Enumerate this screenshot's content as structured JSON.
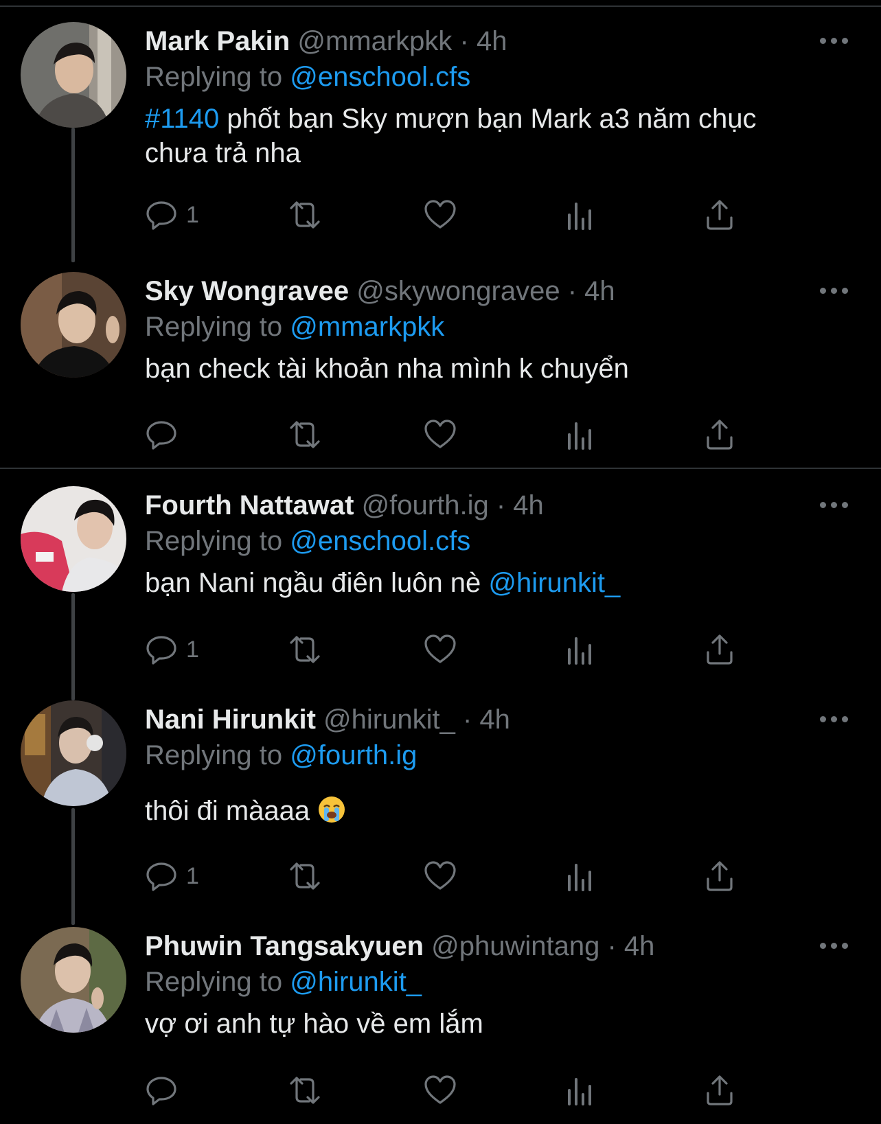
{
  "colors": {
    "background": "#000000",
    "text": "#e7e9ea",
    "muted": "#71767b",
    "link": "#1d9bf0",
    "divider": "#2f3336"
  },
  "tweets": [
    {
      "name": "Mark Pakin",
      "handle": "@mmarkpkk",
      "dot": "·",
      "time": "4h",
      "replying_label": "Replying to",
      "replying_to": "@enschool.cfs",
      "text_link": "#1140",
      "text_main": " phốt bạn Sky mượn bạn Mark a3 năm chục chưa trả nha",
      "text_tail_link": "",
      "reply_count": "1",
      "avatar_icon": "avatar-mark-pakin"
    },
    {
      "name": "Sky Wongravee",
      "handle": "@skywongravee",
      "dot": "·",
      "time": "4h",
      "replying_label": "Replying to",
      "replying_to": "@mmarkpkk",
      "text_link": "",
      "text_main": "bạn check tài khoản nha mình k chuyển",
      "text_tail_link": "",
      "reply_count": "",
      "avatar_icon": "avatar-sky-wongravee"
    },
    {
      "name": "Fourth Nattawat",
      "handle": "@fourth.ig",
      "dot": "·",
      "time": "4h",
      "replying_label": "Replying to",
      "replying_to": "@enschool.cfs",
      "text_link": "",
      "text_main": "bạn Nani ngầu điên luôn nè ",
      "text_tail_link": "@hirunkit_",
      "reply_count": "1",
      "avatar_icon": "avatar-fourth-nattawat"
    },
    {
      "name": "Nani Hirunkit",
      "handle": "@hirunkit_",
      "dot": "·",
      "time": "4h",
      "replying_label": "Replying to",
      "replying_to": "@fourth.ig",
      "text_link": "",
      "text_main": "thôi đi màaaa ",
      "text_tail_link": "",
      "reply_count": "1",
      "avatar_icon": "avatar-nani-hirunkit",
      "emoji_icon": "loudly-crying-face-icon"
    },
    {
      "name": "Phuwin Tangsakyuen",
      "handle": "@phuwintang",
      "dot": "·",
      "time": "4h",
      "replying_label": "Replying to",
      "replying_to": "@hirunkit_",
      "text_link": "",
      "text_main": "vợ ơi anh tự hào về em lắm",
      "text_tail_link": "",
      "reply_count": "",
      "avatar_icon": "avatar-phuwin-tangsakyuen"
    }
  ]
}
